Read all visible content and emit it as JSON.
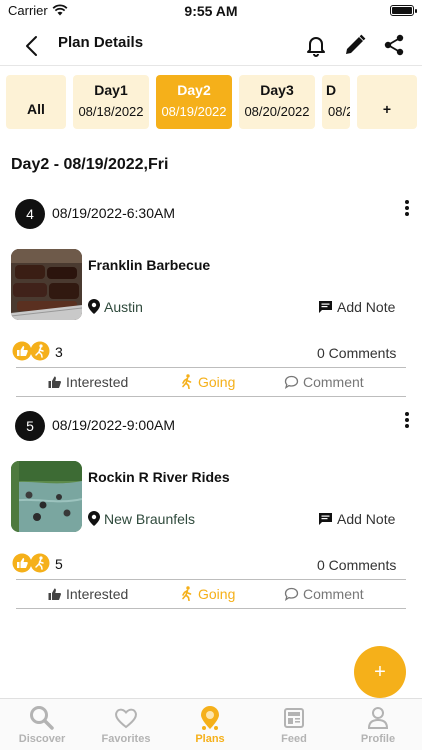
{
  "status_bar": {
    "carrier": "Carrier",
    "time": "9:55 AM"
  },
  "nav": {
    "title": "Plan Details"
  },
  "day_tabs": [
    {
      "label": "All"
    },
    {
      "label": "Day1",
      "date": "08/18/2022"
    },
    {
      "label": "Day2",
      "date": "08/19/2022",
      "active": true
    },
    {
      "label": "Day3",
      "date": "08/20/2022"
    },
    {
      "label": "D",
      "date": "08/2"
    },
    {
      "label": "+"
    }
  ],
  "section_heading": "Day2 - 08/19/2022,Fri",
  "plans": [
    {
      "number": "4",
      "datetime": "08/19/2022-6:30AM",
      "name": "Franklin Barbecue",
      "location": "Austin",
      "add_note": "Add Note",
      "reactions": "3",
      "comments": "0 Comments",
      "interested": "Interested",
      "going": "Going",
      "comment": "Comment"
    },
    {
      "number": "5",
      "datetime": "08/19/2022-9:00AM",
      "name": "Rockin R River Rides",
      "location": "New Braunfels",
      "add_note": "Add Note",
      "reactions": "5",
      "comments": "0 Comments",
      "interested": "Interested",
      "going": "Going",
      "comment": "Comment"
    }
  ],
  "fab_label": "+",
  "tabs": [
    {
      "label": "Discover",
      "icon": "search-icon"
    },
    {
      "label": "Favorites",
      "icon": "heart-icon"
    },
    {
      "label": "Plans",
      "icon": "plans-pin-icon",
      "active": true
    },
    {
      "label": "Feed",
      "icon": "feed-icon"
    },
    {
      "label": "Profile",
      "icon": "profile-icon"
    }
  ],
  "colors": {
    "accent": "#f5b01a",
    "chip_bg": "#fdf2d6"
  }
}
